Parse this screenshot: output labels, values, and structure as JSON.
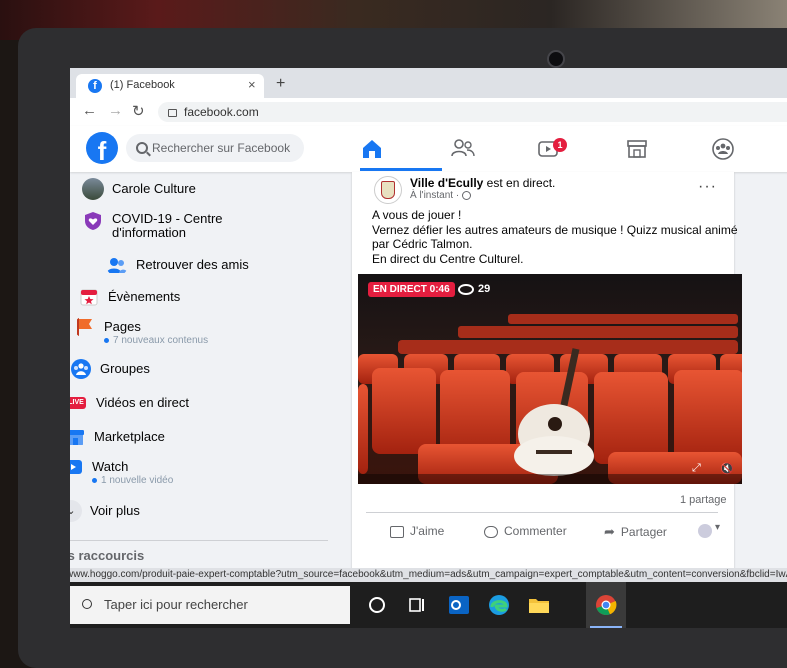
{
  "browser": {
    "tab_title": "(1) Facebook",
    "tab_close": "×",
    "new_tab": "+",
    "url": "facebook.com",
    "nav_back": "←",
    "nav_forward": "→",
    "nav_reload": "↻"
  },
  "header": {
    "logo_letter": "f",
    "search_placeholder": "Rechercher sur Facebook",
    "watch_badge": "1"
  },
  "sidebar": {
    "items": [
      {
        "label": "Carole Culture"
      },
      {
        "label": "COVID-19 - Centre",
        "label2": "d'information"
      },
      {
        "label": "Retrouver des amis"
      },
      {
        "label": "Évènements"
      },
      {
        "label": "Pages",
        "sub": "7 nouveaux contenus"
      },
      {
        "label": "Groupes"
      },
      {
        "label": "Vidéos en direct",
        "icon_text": "LIVE"
      },
      {
        "label": "Marketplace"
      },
      {
        "label": "Watch",
        "sub": "1 nouvelle vidéo"
      },
      {
        "label": "Voir plus"
      }
    ],
    "shortcuts_title": "Vos raccourcis"
  },
  "post": {
    "author": "Ville d'Ecully",
    "status": " est en direct.",
    "time": "À l'instant · ",
    "more": "···",
    "lines": [
      "A vous de jouer !",
      "Vernez défier les autres amateurs de musique ! Quizz musical animé",
      "par Cédric Talmon.",
      "En direct du Centre Culturel."
    ],
    "live_label": "EN DIRECT 0:46",
    "viewers": "29",
    "shares": "1 partage",
    "actions": {
      "like": "J'aime",
      "comment": "Commenter",
      "share": "Partager"
    }
  },
  "statusbar": {
    "url": "https://www.hoggo.com/produit-paie-expert-comptable?utm_source=facebook&utm_medium=ads&utm_campaign=expert_comptable&utm_content=conversion&fbclid=IwA"
  },
  "taskbar": {
    "search_placeholder": "Taper ici pour rechercher"
  },
  "colors": {
    "facebook_blue": "#1877f2",
    "live_red": "#e41e3f",
    "seat_red": "#d83a22"
  }
}
